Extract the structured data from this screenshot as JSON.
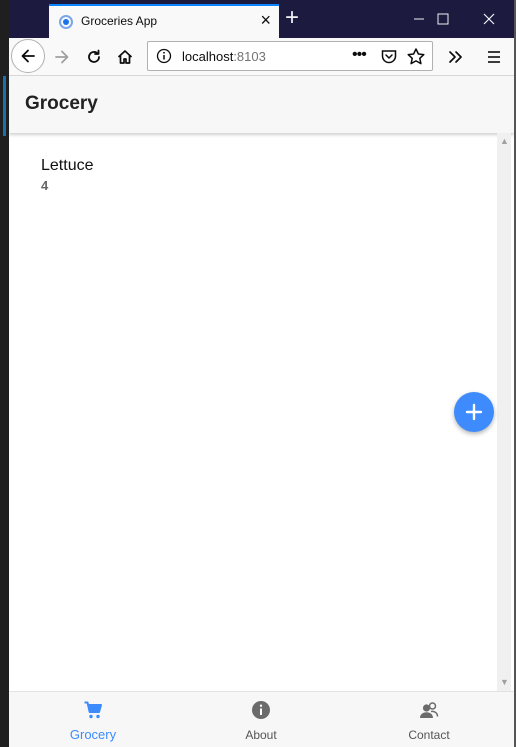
{
  "browser": {
    "tab_title": "Groceries App",
    "url_host": "localhost",
    "url_port": ":8103",
    "new_tab": "+",
    "close_tab": "×"
  },
  "app": {
    "header_title": "Grocery",
    "items": [
      {
        "name": "Lettuce",
        "quantity": "4"
      }
    ]
  },
  "bottom_nav": [
    {
      "label": "Grocery",
      "icon": "cart-icon",
      "active": true
    },
    {
      "label": "About",
      "icon": "info-icon",
      "active": false
    },
    {
      "label": "Contact",
      "icon": "contact-icon",
      "active": false
    }
  ],
  "colors": {
    "accent": "#3d8bfd",
    "tabbar": "#1c1b3f",
    "header_bg": "#f7f7f7"
  }
}
